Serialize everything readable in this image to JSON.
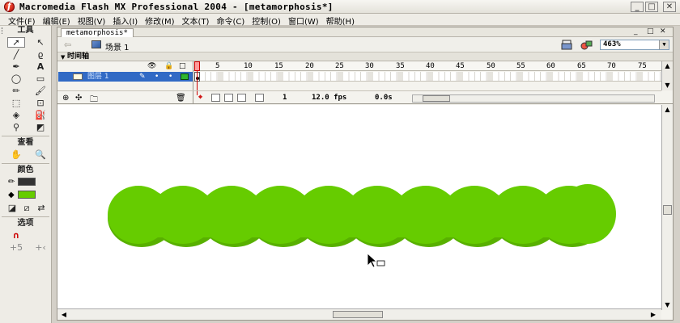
{
  "window": {
    "title": "Macromedia Flash MX Professional 2004 - [metamorphosis*]",
    "controls": [
      "_",
      "□",
      "✕"
    ]
  },
  "menu": [
    "文件(F)",
    "编辑(E)",
    "视图(V)",
    "插入(I)",
    "修改(M)",
    "文本(T)",
    "命令(C)",
    "控制(O)",
    "窗口(W)",
    "帮助(H)"
  ],
  "tools": {
    "title": "工具",
    "view_title": "查看",
    "colors_title": "颜色",
    "options_title": "选项",
    "stroke_color": "#333333",
    "fill_color": "#66cc00"
  },
  "document": {
    "tab_label": "metamorphosis*",
    "doc_controls": [
      "_",
      "□",
      "✕"
    ],
    "scene_label": "场景 1",
    "zoom": "463%"
  },
  "timeline": {
    "header": "时间轴",
    "layer_name": "图层 1",
    "ruler_ticks": [
      "1",
      "5",
      "10",
      "15",
      "20",
      "25",
      "30",
      "35",
      "40",
      "45",
      "50",
      "55",
      "60",
      "65",
      "70",
      "75"
    ],
    "current_frame": "1",
    "frame_rate": "12.0 fps",
    "elapsed_time": "0.0s"
  },
  "stage": {
    "shape_color": "#66cc00",
    "shape_shadow": "#58b000"
  }
}
